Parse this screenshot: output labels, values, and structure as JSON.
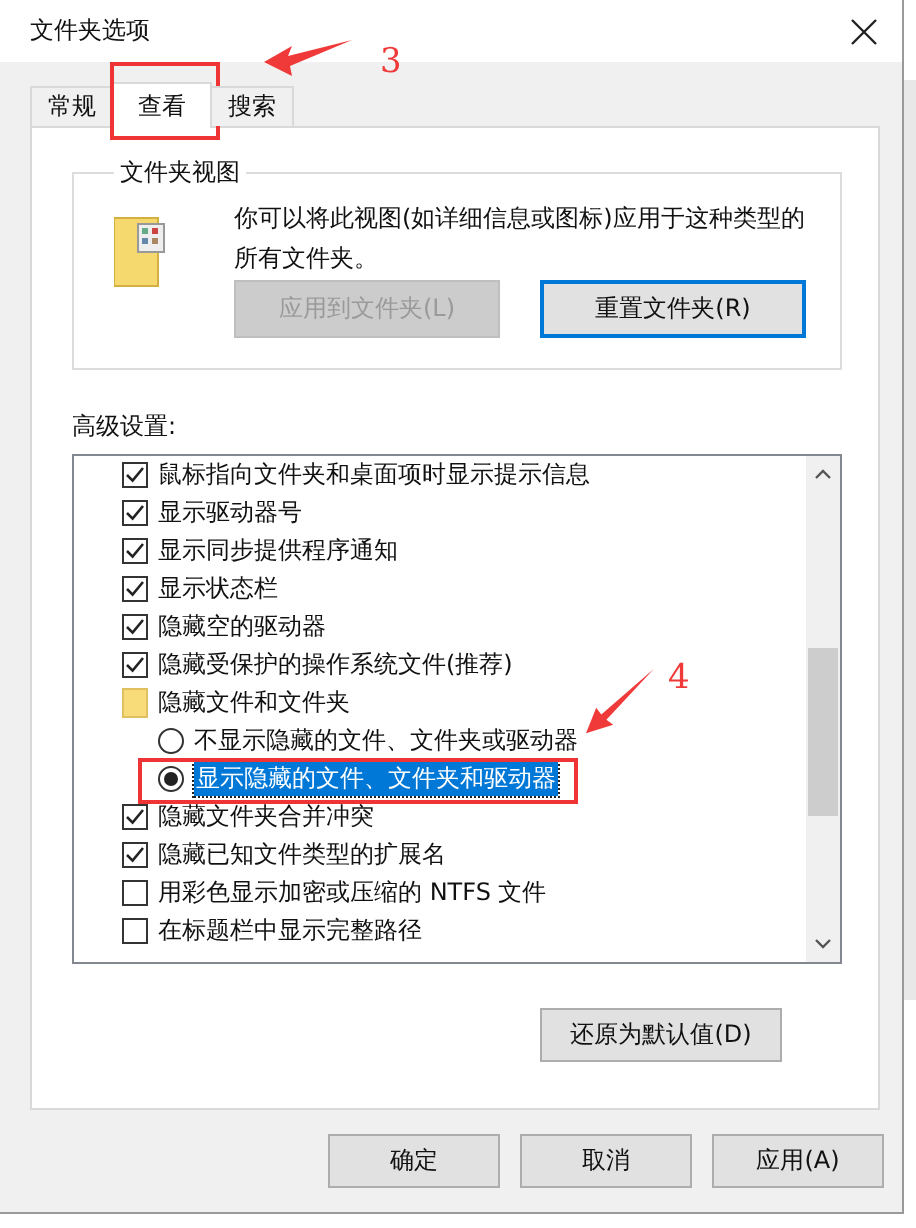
{
  "window": {
    "title": "文件夹选项"
  },
  "tabs": [
    {
      "label": "常规",
      "selected": false,
      "highlighted": false
    },
    {
      "label": "查看",
      "selected": true,
      "highlighted": true
    },
    {
      "label": "搜索",
      "selected": false,
      "highlighted": false
    }
  ],
  "folder_views": {
    "title": "文件夹视图",
    "description": "你可以将此视图(如详细信息或图标)应用于这种类型的所有文件夹。",
    "buttons": [
      {
        "label": "应用到文件夹(L)",
        "disabled": true,
        "focused": false
      },
      {
        "label": "重置文件夹(R)",
        "disabled": false,
        "focused": true
      }
    ]
  },
  "advanced": {
    "label": "高级设置:",
    "items": [
      {
        "kind": "checkbox",
        "label": "鼠标指向文件夹和桌面项时显示提示信息",
        "checked": true
      },
      {
        "kind": "checkbox",
        "label": "显示驱动器号",
        "checked": true
      },
      {
        "kind": "checkbox",
        "label": "显示同步提供程序通知",
        "checked": true
      },
      {
        "kind": "checkbox",
        "label": "显示状态栏",
        "checked": true
      },
      {
        "kind": "checkbox",
        "label": "隐藏空的驱动器",
        "checked": true
      },
      {
        "kind": "checkbox",
        "label": "隐藏受保护的操作系统文件(推荐)",
        "checked": true
      },
      {
        "kind": "folder",
        "label": "隐藏文件和文件夹",
        "children": [
          {
            "kind": "radio",
            "label": "不显示隐藏的文件、文件夹或驱动器",
            "selected": false,
            "highlighted": false
          },
          {
            "kind": "radio",
            "label": "显示隐藏的文件、文件夹和驱动器",
            "selected": true,
            "highlighted": true
          }
        ]
      },
      {
        "kind": "checkbox",
        "label": "隐藏文件夹合并冲突",
        "checked": true
      },
      {
        "kind": "checkbox",
        "label": "隐藏已知文件类型的扩展名",
        "checked": true
      },
      {
        "kind": "checkbox",
        "label": "用彩色显示加密或压缩的 NTFS 文件",
        "checked": false
      },
      {
        "kind": "checkbox",
        "label": "在标题栏中显示完整路径",
        "checked": false
      }
    ]
  },
  "restore_button": "还原为默认值(D)",
  "buttons": [
    "确定",
    "取消",
    "应用(A)"
  ],
  "annotations": [
    {
      "label": "3"
    },
    {
      "label": "4"
    }
  ]
}
